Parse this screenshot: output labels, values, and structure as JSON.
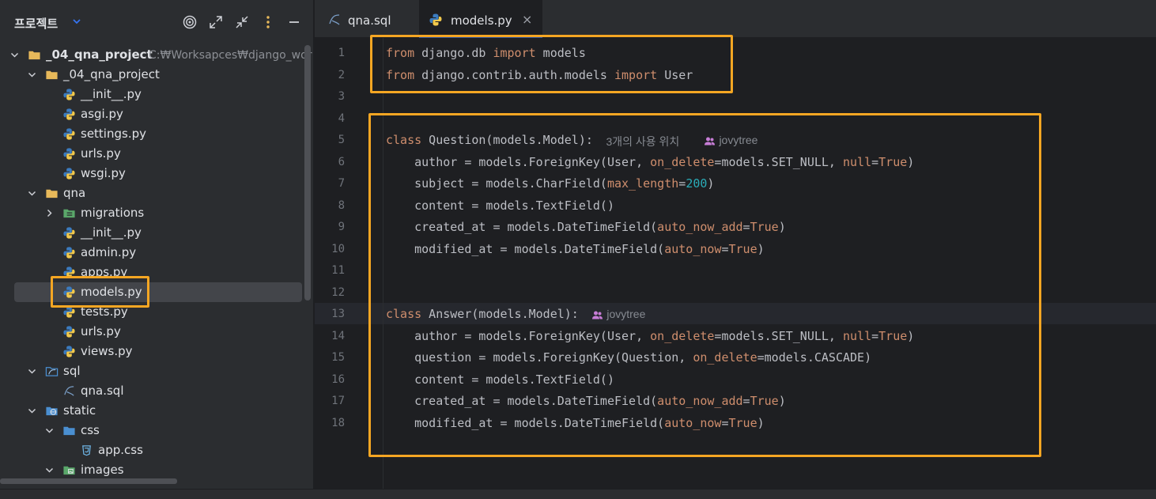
{
  "sidebar": {
    "title": "프로젝트",
    "header_icons": [
      "target-icon",
      "expand-icon",
      "collapse-icon",
      "more-vertical-icon",
      "minimize-icon"
    ],
    "tree": [
      {
        "label": "_04_qna_project",
        "path": "C:₩Worksapces₩django_wor",
        "icon": "folder-icon",
        "depth": 0,
        "expanded": true,
        "bold": true
      },
      {
        "label": "_04_qna_project",
        "icon": "folder-icon",
        "depth": 1,
        "expanded": true
      },
      {
        "label": "__init__.py",
        "icon": "python-icon",
        "depth": 2
      },
      {
        "label": "asgi.py",
        "icon": "python-icon",
        "depth": 2
      },
      {
        "label": "settings.py",
        "icon": "python-icon",
        "depth": 2
      },
      {
        "label": "urls.py",
        "icon": "python-icon",
        "depth": 2
      },
      {
        "label": "wsgi.py",
        "icon": "python-icon",
        "depth": 2
      },
      {
        "label": "qna",
        "icon": "folder-icon",
        "depth": 1,
        "expanded": true
      },
      {
        "label": "migrations",
        "icon": "migrations-folder-icon",
        "depth": 2,
        "expanded": false
      },
      {
        "label": "__init__.py",
        "icon": "python-icon",
        "depth": 2
      },
      {
        "label": "admin.py",
        "icon": "python-icon",
        "depth": 2
      },
      {
        "label": "apps.py",
        "icon": "python-icon",
        "depth": 2
      },
      {
        "label": "models.py",
        "icon": "python-icon",
        "depth": 2,
        "selected": true
      },
      {
        "label": "tests.py",
        "icon": "python-icon",
        "depth": 2
      },
      {
        "label": "urls.py",
        "icon": "python-icon",
        "depth": 2
      },
      {
        "label": "views.py",
        "icon": "python-icon",
        "depth": 2
      },
      {
        "label": "sql",
        "icon": "sql-folder-icon",
        "depth": 1,
        "expanded": true
      },
      {
        "label": "qna.sql",
        "icon": "sql-file-icon",
        "depth": 2
      },
      {
        "label": "static",
        "icon": "web-folder-icon",
        "depth": 1,
        "expanded": true
      },
      {
        "label": "css",
        "icon": "css-folder-icon",
        "depth": 2,
        "expanded": true
      },
      {
        "label": "app.css",
        "icon": "css-file-icon",
        "depth": 3
      },
      {
        "label": "images",
        "icon": "images-folder-icon",
        "depth": 2,
        "expanded": true
      }
    ]
  },
  "tabs": [
    {
      "label": "qna.sql",
      "icon": "sql-file-icon",
      "active": false
    },
    {
      "label": "models.py",
      "icon": "python-icon",
      "active": true,
      "close": "×"
    }
  ],
  "editor": {
    "lines": [
      {
        "n": "1",
        "tokens": [
          [
            "kw",
            "from"
          ],
          [
            "t",
            " django.db "
          ],
          [
            "kw",
            "import"
          ],
          [
            "t",
            " models"
          ]
        ]
      },
      {
        "n": "2",
        "tokens": [
          [
            "kw",
            "from"
          ],
          [
            "t",
            " django.contrib.auth.models "
          ],
          [
            "kw",
            "import"
          ],
          [
            "t",
            " User"
          ]
        ]
      },
      {
        "n": "3",
        "tokens": []
      },
      {
        "n": "4",
        "tokens": []
      },
      {
        "n": "5",
        "tokens": [
          [
            "kw",
            "class"
          ],
          [
            "t",
            " Question(models.Model):"
          ]
        ],
        "hint": "3개의 사용 위치",
        "author": "jovytree"
      },
      {
        "n": "6",
        "tokens": [
          [
            "t",
            "    author = models.ForeignKey(User, "
          ],
          [
            "param",
            "on_delete"
          ],
          [
            "t",
            "=models.SET_NULL, "
          ],
          [
            "param",
            "null"
          ],
          [
            "t",
            "="
          ],
          [
            "kw",
            "True"
          ],
          [
            "t",
            ")"
          ]
        ]
      },
      {
        "n": "7",
        "tokens": [
          [
            "t",
            "    subject = models.CharField("
          ],
          [
            "param",
            "max_length"
          ],
          [
            "t",
            "="
          ],
          [
            "num",
            "200"
          ],
          [
            "t",
            ")"
          ]
        ]
      },
      {
        "n": "8",
        "tokens": [
          [
            "t",
            "    content = models.TextField()"
          ]
        ]
      },
      {
        "n": "9",
        "tokens": [
          [
            "t",
            "    created_at = models.DateTimeField("
          ],
          [
            "param",
            "auto_now_add"
          ],
          [
            "t",
            "="
          ],
          [
            "kw",
            "True"
          ],
          [
            "t",
            ")"
          ]
        ]
      },
      {
        "n": "10",
        "tokens": [
          [
            "t",
            "    modified_at = models.DateTimeField("
          ],
          [
            "param",
            "auto_now"
          ],
          [
            "t",
            "="
          ],
          [
            "kw",
            "True"
          ],
          [
            "t",
            ")"
          ]
        ]
      },
      {
        "n": "11",
        "tokens": []
      },
      {
        "n": "12",
        "tokens": []
      },
      {
        "n": "13",
        "tokens": [
          [
            "kw",
            "class"
          ],
          [
            "t",
            " Answer(models.Model):"
          ]
        ],
        "author": "jovytree"
      },
      {
        "n": "14",
        "tokens": [
          [
            "t",
            "    author = models.ForeignKey(User, "
          ],
          [
            "param",
            "on_delete"
          ],
          [
            "t",
            "=models.SET_NULL, "
          ],
          [
            "param",
            "null"
          ],
          [
            "t",
            "="
          ],
          [
            "kw",
            "True"
          ],
          [
            "t",
            ")"
          ]
        ]
      },
      {
        "n": "15",
        "tokens": [
          [
            "t",
            "    question = models.ForeignKey(Question, "
          ],
          [
            "param",
            "on_delete"
          ],
          [
            "t",
            "=models.CASCADE)"
          ]
        ]
      },
      {
        "n": "16",
        "tokens": [
          [
            "t",
            "    content = models.TextField()"
          ]
        ]
      },
      {
        "n": "17",
        "tokens": [
          [
            "t",
            "    created_at = models.DateTimeField("
          ],
          [
            "param",
            "auto_now_add"
          ],
          [
            "t",
            "="
          ],
          [
            "kw",
            "True"
          ],
          [
            "t",
            ")"
          ]
        ]
      },
      {
        "n": "18",
        "tokens": [
          [
            "t",
            "    modified_at = models.DateTimeField("
          ],
          [
            "param",
            "auto_now"
          ],
          [
            "t",
            "="
          ],
          [
            "kw",
            "True"
          ],
          [
            "t",
            ")"
          ]
        ]
      }
    ]
  },
  "colors": {
    "highlight_box": "#f5a623",
    "keyword": "#cf8e6d",
    "number": "#2aacb8",
    "text": "#bcbec4",
    "python_blue": "#3b7bbf",
    "python_yellow": "#f2c94c",
    "folder": "#e8b95a"
  }
}
